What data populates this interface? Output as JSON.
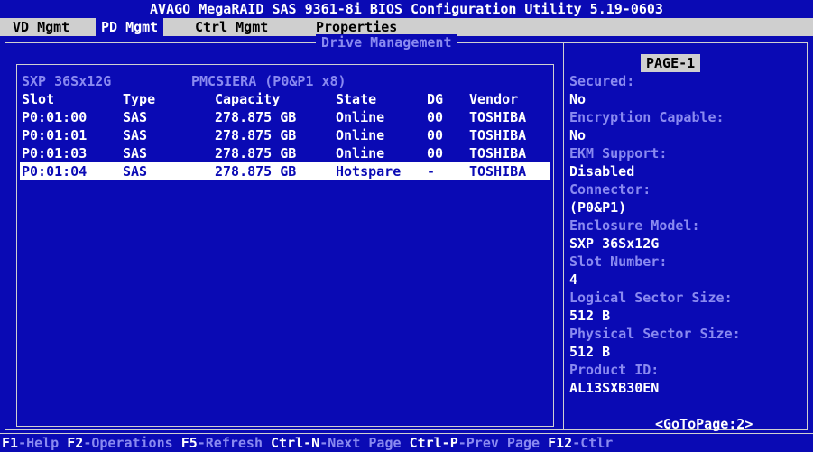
{
  "title": "AVAGO MegaRAID SAS 9361-8i BIOS Configuration Utility 5.19-0603",
  "menu": [
    {
      "label": "VD Mgmt",
      "active": false
    },
    {
      "label": "PD Mgmt",
      "active": true
    },
    {
      "label": "Ctrl Mgmt",
      "active": false
    },
    {
      "label": "Properties",
      "active": false
    }
  ],
  "frame_title": "Drive Management",
  "enclosure": {
    "name": "SXP 36Sx12G",
    "controller": "PMCSIERA (P0&P1 x8)"
  },
  "table": {
    "columns": [
      "Slot",
      "Type",
      "Capacity",
      "State",
      "DG",
      "Vendor"
    ],
    "rows": [
      {
        "slot": "P0:01:00",
        "type": "SAS",
        "capacity": "278.875 GB",
        "state": "Online",
        "dg": "00",
        "vendor": "TOSHIBA"
      },
      {
        "slot": "P0:01:01",
        "type": "SAS",
        "capacity": "278.875 GB",
        "state": "Online",
        "dg": "00",
        "vendor": "TOSHIBA"
      },
      {
        "slot": "P0:01:03",
        "type": "SAS",
        "capacity": "278.875 GB",
        "state": "Online",
        "dg": "00",
        "vendor": "TOSHIBA"
      },
      {
        "slot": "P0:01:04",
        "type": "SAS",
        "capacity": "278.875 GB",
        "state": "Hotspare",
        "dg": "-",
        "vendor": "TOSHIBA"
      }
    ],
    "selected_row": 3
  },
  "properties": {
    "page_label": "PAGE-1",
    "items": [
      {
        "label": "Secured:",
        "value": "No"
      },
      {
        "label": "Encryption Capable:",
        "value": "No"
      },
      {
        "label": "EKM Support:",
        "value": "Disabled"
      },
      {
        "label": "Connector:",
        "value": "(P0&P1)"
      },
      {
        "label": "Enclosure Model:",
        "value": "SXP 36Sx12G"
      },
      {
        "label": "Slot Number:",
        "value": "4"
      },
      {
        "label": "Logical Sector Size:",
        "value": "512 B"
      },
      {
        "label": "Physical Sector Size:",
        "value": "512 B"
      },
      {
        "label": "Product ID:",
        "value": "AL13SXB30EN"
      }
    ],
    "goto_label": "<GoToPage:2>"
  },
  "statusbar": [
    {
      "key": "F1",
      "desc": "-Help "
    },
    {
      "key": "F2",
      "desc": "-Operations "
    },
    {
      "key": "F5",
      "desc": "-Refresh "
    },
    {
      "key": "Ctrl-N",
      "desc": "-Next Page "
    },
    {
      "key": "Ctrl-P",
      "desc": "-Prev Page "
    },
    {
      "key": "F12",
      "desc": "-Ctlr"
    }
  ],
  "colors": {
    "background": "#0a0ab4",
    "menu_bg": "#cfcfcf",
    "label_text": "#8a8af0",
    "value_text": "#ffffff",
    "selection_bg": "#ffffff"
  }
}
